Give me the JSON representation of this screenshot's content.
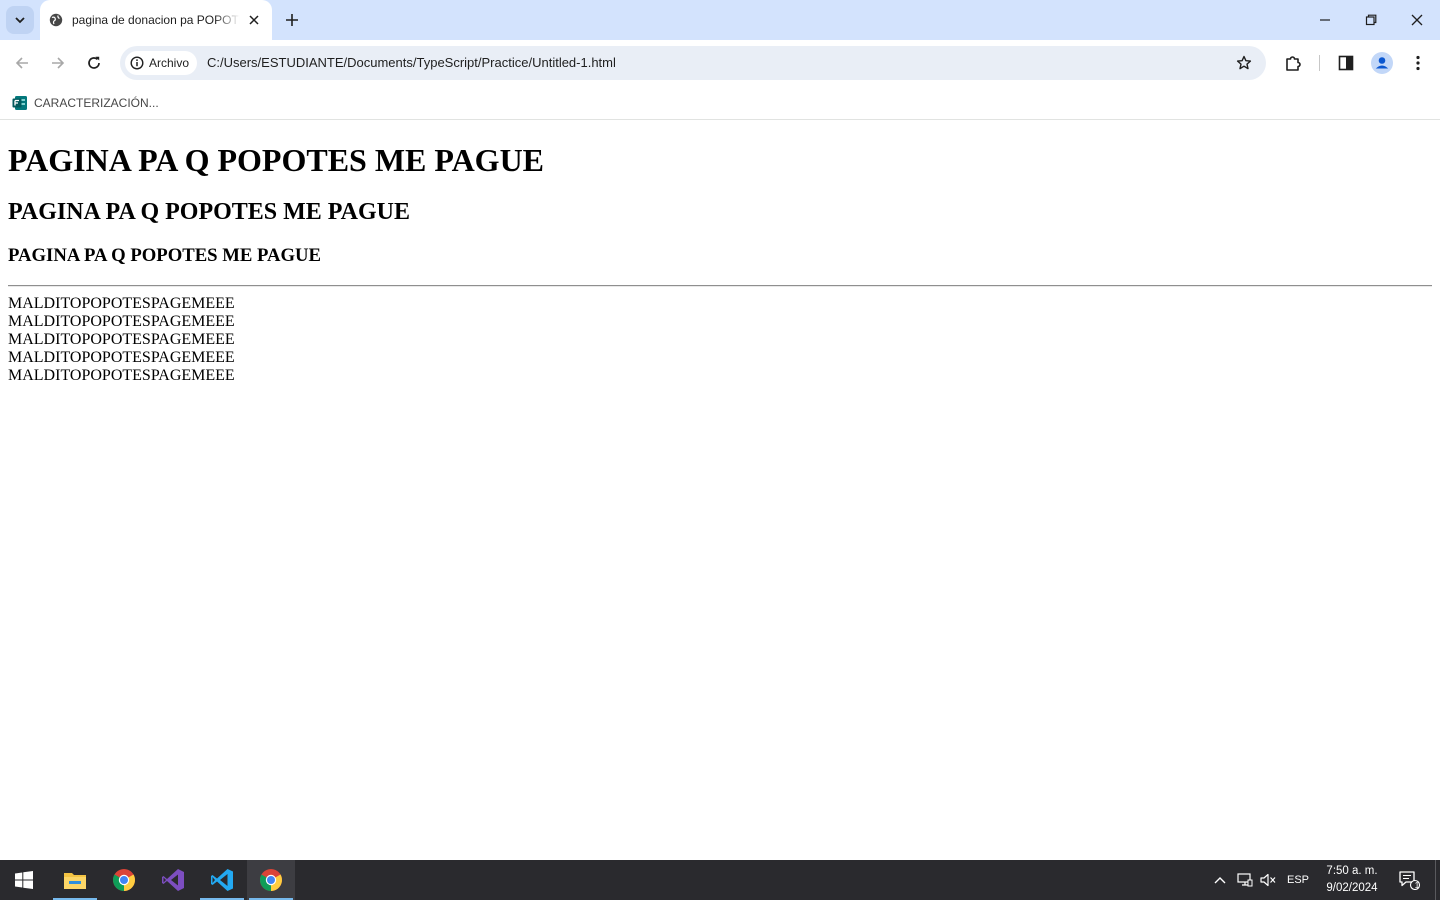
{
  "browser": {
    "tab": {
      "title": "pagina de donacion pa POPOTES"
    },
    "toolbar": {
      "security_chip_label": "Archivo",
      "url": "C:/Users/ESTUDIANTE/Documents/TypeScript/Practice/Untitled-1.html"
    },
    "bookmarks": [
      {
        "label": "CARACTERIZACIÓN..."
      }
    ]
  },
  "page": {
    "h1": "PAGINA PA Q POPOTES ME PAGUE",
    "h2": "PAGINA PA Q POPOTES ME PAGUE",
    "h3": "PAGINA PA Q POPOTES ME PAGUE",
    "lines": [
      "MALDITOPOPOTESPAGEMEEE",
      "MALDITOPOPOTESPAGEMEEE",
      "MALDITOPOPOTESPAGEMEEE",
      "MALDITOPOPOTESPAGEMEEE",
      "MALDITOPOPOTESPAGEMEEE"
    ]
  },
  "taskbar": {
    "apps": [
      {
        "name": "file-explorer-icon"
      },
      {
        "name": "chrome-icon"
      },
      {
        "name": "visual-studio-icon"
      },
      {
        "name": "vscode-icon"
      },
      {
        "name": "chrome-icon"
      }
    ],
    "language": "ESP",
    "time": "7:50 a. m.",
    "date": "9/02/2024",
    "notification_count": "1"
  },
  "colors": {
    "tabstrip": "#d3e3fd",
    "omnibox": "#e9eef6",
    "taskbar": "#2a2a2e",
    "accent": "#0b57d0"
  }
}
